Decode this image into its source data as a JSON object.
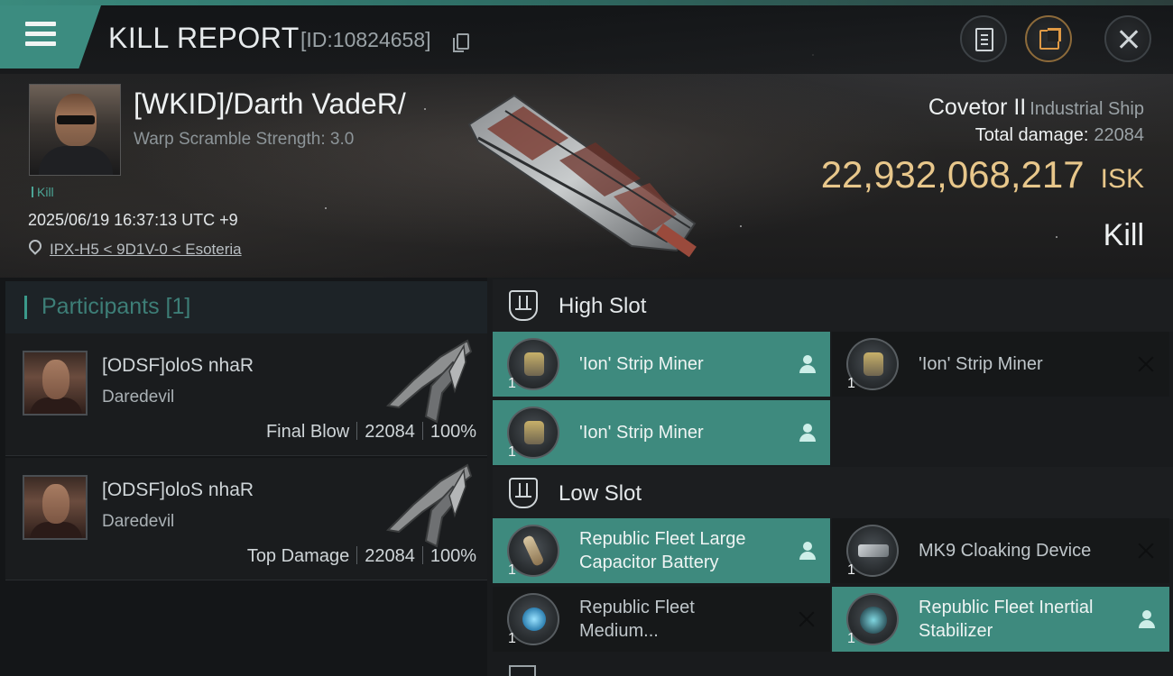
{
  "header": {
    "title": "KILL REPORT",
    "report_id": "[ID:10824658]",
    "menu_icon": "hamburger-menu-icon",
    "actions": [
      "clipboard-icon",
      "share-icon",
      "close-icon"
    ]
  },
  "victim": {
    "name": "[WKID]/Darth VadeR/",
    "warp_scramble": "Warp Scramble Strength: 3.0",
    "result_tag": "Kill",
    "timestamp": "2025/06/19 16:37:13 UTC +9",
    "location": "IPX-H5 < 9D1V-0 < Esoteria",
    "ship_name": "Covetor II",
    "ship_class": "Industrial Ship",
    "total_damage_label": "Total damage:",
    "total_damage": "22084",
    "isk_value": "22,932,068,217",
    "isk_unit": "ISK",
    "outcome": "Kill"
  },
  "participants": {
    "title": "Participants [1]",
    "rows": [
      {
        "name": "[ODSF]oloS nhaR",
        "ship": "Daredevil",
        "role": "Final Blow",
        "damage": "22084",
        "percent": "100%"
      },
      {
        "name": "[ODSF]oloS nhaR",
        "ship": "Daredevil",
        "role": "Top Damage",
        "damage": "22084",
        "percent": "100%"
      }
    ]
  },
  "fitting": {
    "high_slot": {
      "title": "High Slot",
      "modules": [
        {
          "name": "'Ion' Strip Miner",
          "qty": "1",
          "state": "dropped"
        },
        {
          "name": "'Ion' Strip Miner",
          "qty": "1",
          "state": "destroyed"
        },
        {
          "name": "'Ion' Strip Miner",
          "qty": "1",
          "state": "dropped"
        }
      ]
    },
    "low_slot": {
      "title": "Low Slot",
      "modules": [
        {
          "name": "Republic Fleet Large Capacitor Battery",
          "qty": "1",
          "state": "dropped"
        },
        {
          "name": "MK9 Cloaking Device",
          "qty": "1",
          "state": "destroyed"
        },
        {
          "name": "Republic Fleet Medium...",
          "qty": "1",
          "state": "destroyed"
        },
        {
          "name": "Republic Fleet Inertial Stabilizer",
          "qty": "1",
          "state": "dropped"
        }
      ]
    }
  },
  "colors": {
    "accent_teal": "#3e8a7e",
    "isk_gold": "#e8c78b",
    "participants_title": "#3d7e77"
  }
}
